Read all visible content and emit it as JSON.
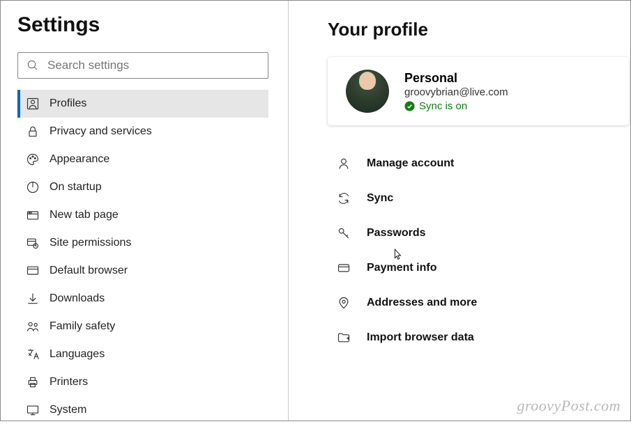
{
  "sidebar": {
    "title": "Settings",
    "search_placeholder": "Search settings",
    "items": [
      {
        "label": "Profiles",
        "active": true
      },
      {
        "label": "Privacy and services"
      },
      {
        "label": "Appearance"
      },
      {
        "label": "On startup"
      },
      {
        "label": "New tab page"
      },
      {
        "label": "Site permissions"
      },
      {
        "label": "Default browser"
      },
      {
        "label": "Downloads"
      },
      {
        "label": "Family safety"
      },
      {
        "label": "Languages"
      },
      {
        "label": "Printers"
      },
      {
        "label": "System"
      }
    ]
  },
  "main": {
    "title": "Your profile",
    "profile": {
      "name": "Personal",
      "email": "groovybrian@live.com",
      "sync_status": "Sync is on",
      "sync_color": "#107c10"
    },
    "rows": [
      {
        "label": "Manage account"
      },
      {
        "label": "Sync"
      },
      {
        "label": "Passwords"
      },
      {
        "label": "Payment info"
      },
      {
        "label": "Addresses and more"
      },
      {
        "label": "Import browser data"
      }
    ]
  },
  "watermark": "groovyPost.com"
}
